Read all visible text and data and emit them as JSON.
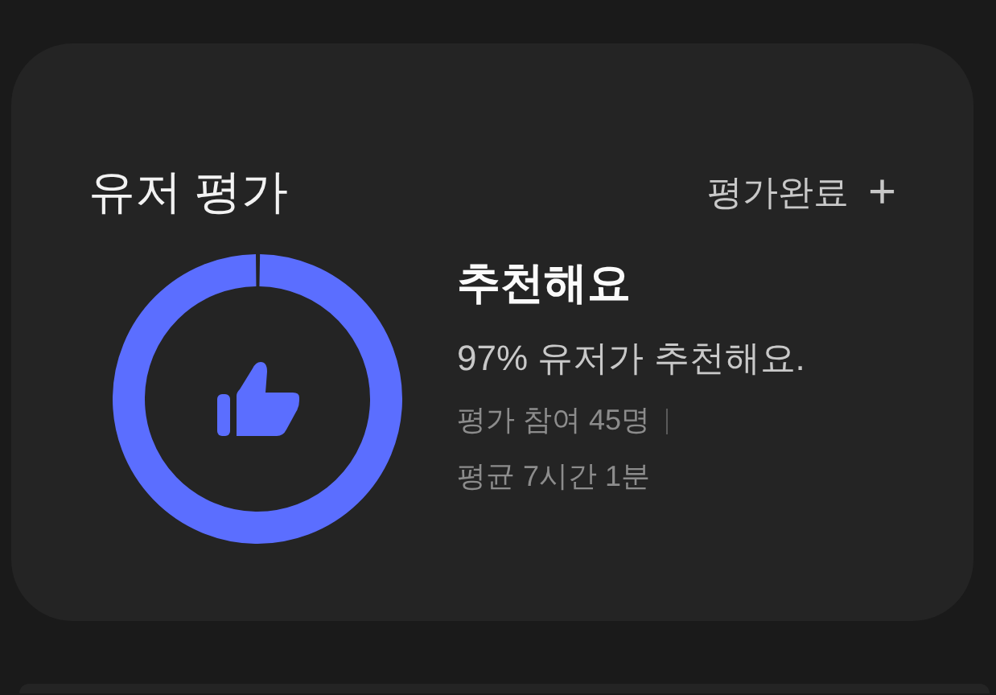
{
  "review": {
    "title": "유저 평가",
    "action": {
      "label": "평가완료",
      "icon": "+"
    },
    "meter": {
      "level": 0.995
    },
    "headline": "추천해요",
    "summary": "97% 유저가 추천해요.",
    "stats": [
      {
        "text": "평가 참여 45명",
        "separator": true
      },
      {
        "text": "평균 7시간 1분",
        "separator": false
      }
    ]
  }
}
